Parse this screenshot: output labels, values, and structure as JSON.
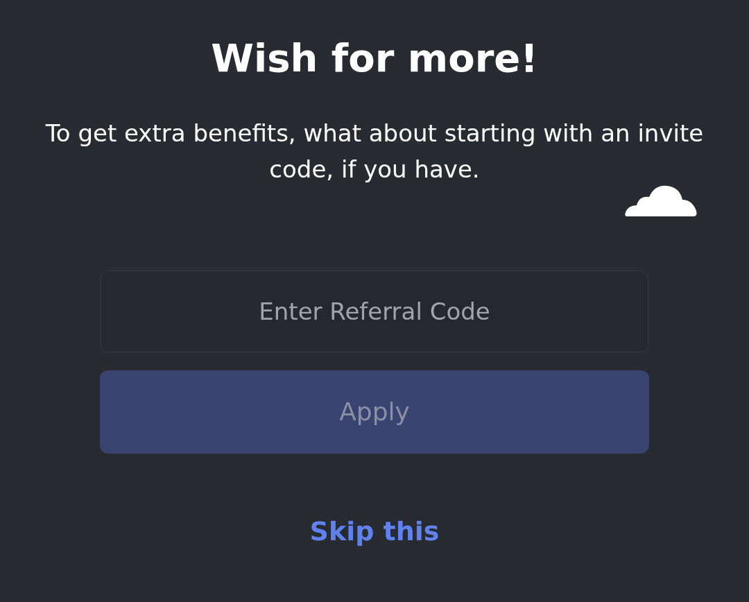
{
  "title": "Wish for more!",
  "message": "To get extra benefits, what about starting with an invite code, if you have.",
  "referral_field": {
    "placeholder": "Enter Referral Code"
  },
  "apply_button": {
    "label": "Apply",
    "disabled": true
  },
  "skip_link": {
    "label": "Skip this"
  }
}
